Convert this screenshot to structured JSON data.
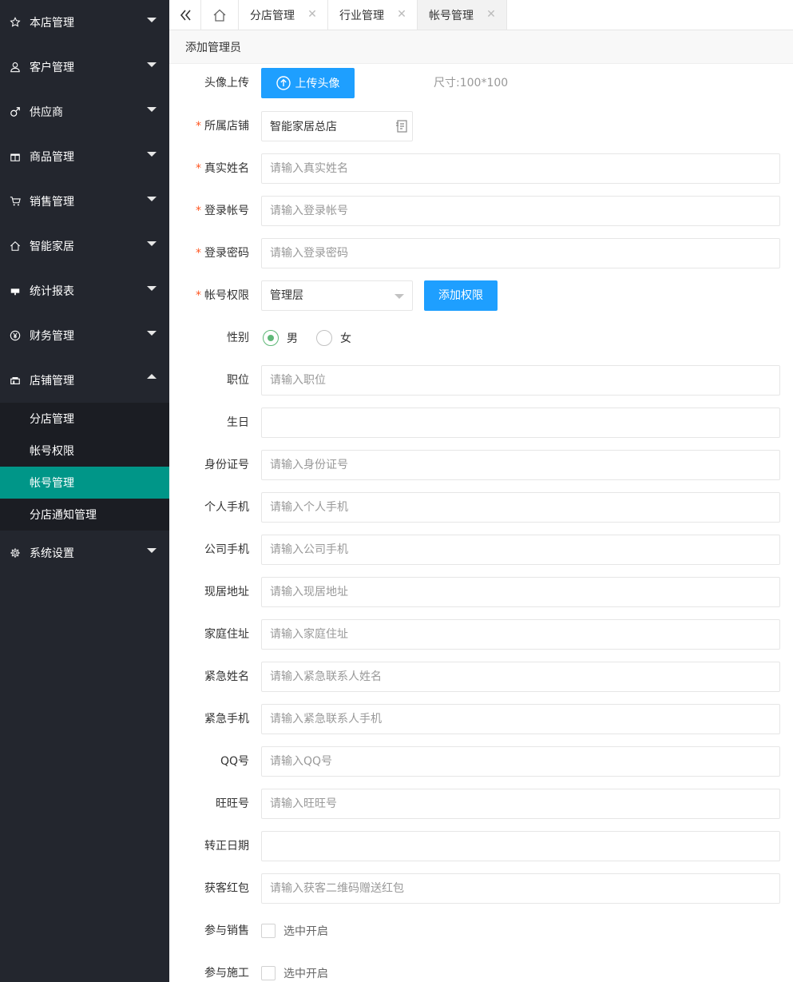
{
  "sidebar": {
    "menu": [
      {
        "label": "本店管理",
        "icon": "star-icon"
      },
      {
        "label": "客户管理",
        "icon": "user-icon"
      },
      {
        "label": "供应商",
        "icon": "male-icon"
      },
      {
        "label": "商品管理",
        "icon": "gift-icon"
      },
      {
        "label": "销售管理",
        "icon": "cart-icon"
      },
      {
        "label": "智能家居",
        "icon": "home-icon"
      },
      {
        "label": "统计报表",
        "icon": "chart-icon"
      },
      {
        "label": "财务管理",
        "icon": "yen-icon"
      },
      {
        "label": "店铺管理",
        "icon": "store-icon"
      }
    ],
    "submenu": [
      {
        "label": "分店管理"
      },
      {
        "label": "帐号权限"
      },
      {
        "label": "帐号管理"
      },
      {
        "label": "分店通知管理"
      }
    ],
    "last": {
      "label": "系统设置",
      "icon": "gear-icon"
    }
  },
  "tabs": [
    {
      "label": "分店管理"
    },
    {
      "label": "行业管理"
    },
    {
      "label": "帐号管理"
    }
  ],
  "tab_close_glyph": "✕",
  "page_title": "添加管理员",
  "form": {
    "avatar_label": "头像上传",
    "upload_button": "上传头像",
    "size_hint": "尺寸:100*100",
    "required_mark": "*",
    "shop_label": "所属店铺",
    "shop_value": "智能家居总店",
    "realname_label": "真实姓名",
    "realname_placeholder": "请输入真实姓名",
    "login_label": "登录帐号",
    "login_placeholder": "请输入登录帐号",
    "password_label": "登录密码",
    "password_placeholder": "请输入登录密码",
    "perm_label": "帐号权限",
    "perm_value": "管理层",
    "add_perm_button": "添加权限",
    "gender_label": "性别",
    "gender_male": "男",
    "gender_female": "女",
    "gender_selected": "男",
    "position_label": "职位",
    "position_placeholder": "请输入职位",
    "birthday_label": "生日",
    "idcard_label": "身份证号",
    "idcard_placeholder": "请输入身份证号",
    "mobile_label": "个人手机",
    "mobile_placeholder": "请输入个人手机",
    "company_mobile_label": "公司手机",
    "company_mobile_placeholder": "请输入公司手机",
    "address_label": "现居地址",
    "address_placeholder": "请输入现居地址",
    "home_label": "家庭住址",
    "home_placeholder": "请输入家庭住址",
    "emergency_name_label": "紧急姓名",
    "emergency_name_placeholder": "请输入紧急联系人姓名",
    "emergency_mobile_label": "紧急手机",
    "emergency_mobile_placeholder": "请输入紧急联系人手机",
    "qq_label": "QQ号",
    "qq_placeholder": "请输入QQ号",
    "wangwang_label": "旺旺号",
    "wangwang_placeholder": "请输入旺旺号",
    "regular_date_label": "转正日期",
    "redpacket_label": "获客红包",
    "redpacket_placeholder": "请输入获客二维码赠送红包",
    "sales_label": "参与销售",
    "sales_check": "选中开启",
    "construction_label": "参与施工",
    "construction_check": "选中开启"
  }
}
